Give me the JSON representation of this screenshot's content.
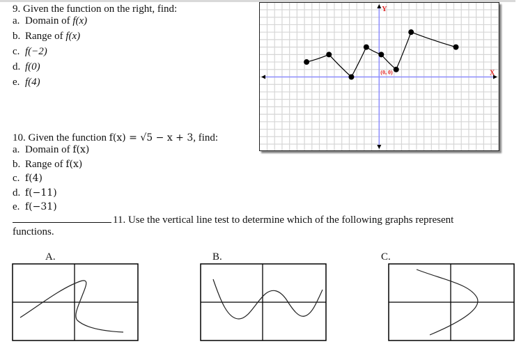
{
  "q9": {
    "title": "9.  Given the function on the right, find:",
    "items": [
      {
        "letter": "a.",
        "text": "Domain of ",
        "math": "f(x)"
      },
      {
        "letter": "b.",
        "text": "Range of ",
        "math": "f(x)"
      },
      {
        "letter": "c.",
        "text": "",
        "math": "f(−2)"
      },
      {
        "letter": "d.",
        "text": "",
        "math": "f(0)"
      },
      {
        "letter": "e.",
        "text": "",
        "math": "f(4)"
      }
    ]
  },
  "q10": {
    "title_prefix": "10.  Given the function ",
    "title_math": "f(x) = √5 − x + 3",
    "title_suffix": ", find:",
    "items": [
      {
        "letter": "a.",
        "text": "Domain of ",
        "math": "f(x)"
      },
      {
        "letter": "b.",
        "text": "Range of ",
        "math": "f(x)"
      },
      {
        "letter": "c.",
        "text": "",
        "math": "f(4)"
      },
      {
        "letter": "d.",
        "text": "",
        "math": "f(−11)"
      },
      {
        "letter": "e.",
        "text": "",
        "math": "f(−31)"
      }
    ]
  },
  "q11": {
    "text_line1": "11.  Use the vertical line test to determine which of the following graphs represent",
    "text_line2": "functions.",
    "graphs": [
      {
        "label": "A."
      },
      {
        "label": "B."
      },
      {
        "label": "C."
      }
    ]
  },
  "chart_data": {
    "type": "line",
    "title": "",
    "xlabel": "X",
    "ylabel": "Y",
    "origin_label": "(0, 0)",
    "grid": true,
    "xlim": [
      -15,
      16
    ],
    "ylim": [
      -10,
      10
    ],
    "points": [
      {
        "x": -10,
        "y": 2
      },
      {
        "x": -7,
        "y": 3
      },
      {
        "x": -4,
        "y": 0
      },
      {
        "x": -2,
        "y": 4
      },
      {
        "x": 0,
        "y": 3
      },
      {
        "x": 2,
        "y": 1
      },
      {
        "x": 4,
        "y": 6
      },
      {
        "x": 10,
        "y": 4
      }
    ],
    "colors": {
      "axis": "#8f8fff",
      "grid": "#d6d6d6",
      "label": "#e02020",
      "curve": "#000000"
    }
  }
}
